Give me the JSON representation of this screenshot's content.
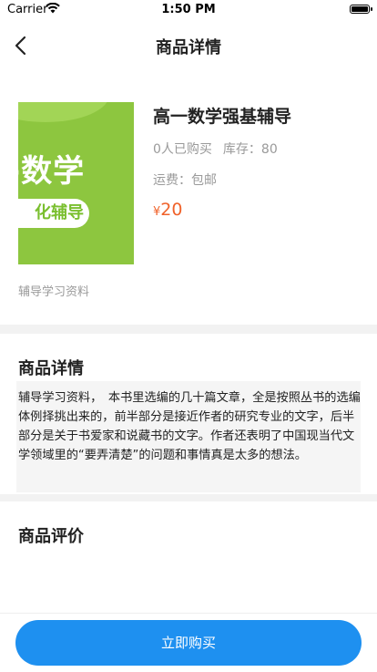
{
  "status": {
    "carrier": "Carrier",
    "time": "1:50 PM"
  },
  "nav": {
    "title": "商品详情"
  },
  "product": {
    "image_text_big": "-数学",
    "image_text_pill": "化辅导",
    "name": "高一数学强基辅导",
    "bought": "0人已购买",
    "stock": "库存：80",
    "shipping": "运费：包邮",
    "currency": "¥",
    "price": "20",
    "caption": "辅导学习资料"
  },
  "details": {
    "title": "商品详情",
    "text": "辅导学习资料，　本书里选编的几十篇文章，全是按照丛书的选编体例择挑出来的，前半部分是接近作者的研究专业的文字，后半部分是关于书爱家和说藏书的文字。作者还表明了中国现当代文学领域里的“要弄清楚”的问题和事情真是太多的想法。"
  },
  "reviews": {
    "title": "商品评价"
  },
  "footer": {
    "buy_label": "立即购买"
  },
  "colors": {
    "accent": "#1e90f0",
    "price": "#f0622a",
    "thumb": "#8dc63f"
  }
}
